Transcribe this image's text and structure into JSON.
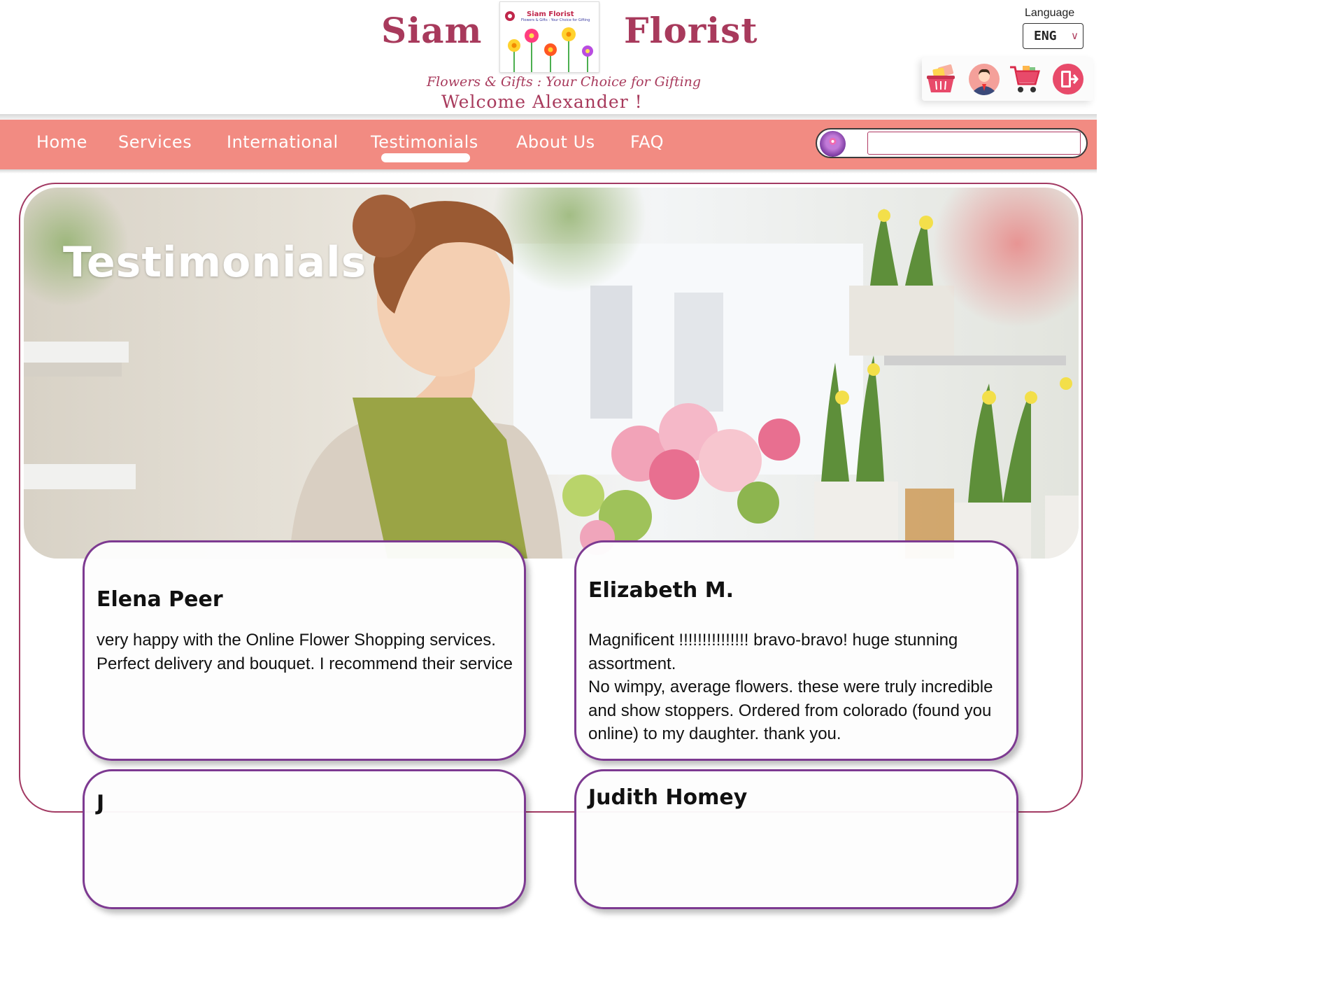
{
  "header": {
    "brand_left": "Siam",
    "brand_right": "Florist",
    "logo_title": "Siam Florist",
    "logo_subtitle": "Flowers & Gifts : Your Choice for Gifting",
    "tagline": "Flowers & Gifts : Your Choice for Gifting",
    "welcome": "Welcome Alexander !",
    "language_label": "Language",
    "language_value": "ENG",
    "icons": [
      "gift-basket-icon",
      "user-profile-icon",
      "shopping-cart-icon",
      "logout-icon"
    ]
  },
  "nav": {
    "items": [
      "Home",
      "Services",
      "International",
      "Testimonials",
      "About Us",
      "FAQ"
    ],
    "active": "Testimonials",
    "search_placeholder": ""
  },
  "hero": {
    "title": "Testimonials"
  },
  "testimonials": [
    {
      "name": "Elena Peer",
      "text": [
        "very happy with the Online Flower Shopping services. Perfect delivery and bouquet. I recommend their service"
      ]
    },
    {
      "name": "Elizabeth M.",
      "text": [
        "Magnificent !!!!!!!!!!!!!!!  bravo-bravo! huge stunning assortment.",
        "No wimpy, average flowers. these were truly incredible and show stoppers. Ordered from colorado (found you online) to my daughter. thank you."
      ]
    },
    {
      "name": "J",
      "text": []
    },
    {
      "name": "Judith Homey",
      "text": []
    }
  ],
  "colors": {
    "brand": "#a83a5c",
    "nav_bg": "#f28b82",
    "card_border": "#7d3a91"
  }
}
